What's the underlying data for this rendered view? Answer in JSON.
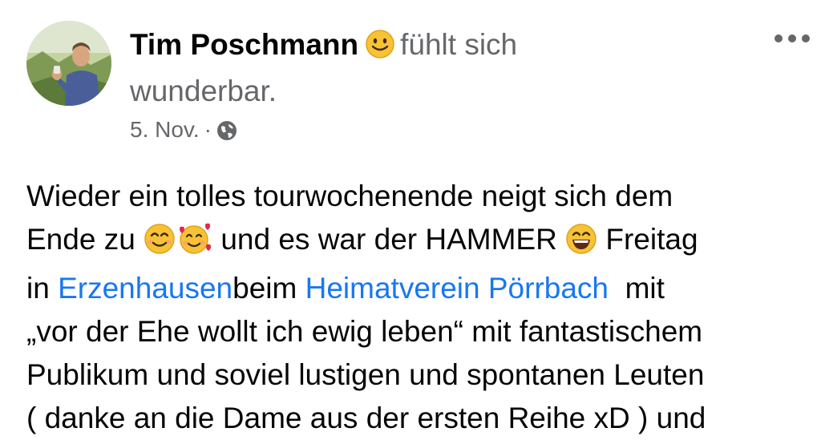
{
  "post": {
    "author": "Tim Poschmann",
    "feeling_prefix": "fühlt sich",
    "feeling_word": "wunderbar.",
    "date": "5. Nov.",
    "separator": "·",
    "icons": {
      "feeling": "slightly-smiling-face-icon",
      "audience": "globe-icon",
      "menu": "more-options-icon"
    },
    "body": {
      "line1": "Wieder ein tolles tourwochenende neigt sich dem",
      "line2_a": "Ende zu",
      "line2_b": "und es war der HAMMER",
      "line2_c": "Freitag",
      "line3_a": "in",
      "line3_link1": "Erzenhausen",
      "line3_b": "beim",
      "line3_link2": "Heimatverein Pörrbach",
      "line3_c": "mit",
      "line4": "„vor der Ehe wollt ich ewig leben“ mit fantastischem",
      "line5": "Publikum und soviel lustigen und spontanen Leuten",
      "line6": "( danke an die Dame aus der ersten Reihe xD ) und"
    },
    "colors": {
      "link": "#1877f2",
      "secondary_text": "#65676b",
      "primary_text": "#050505"
    }
  }
}
